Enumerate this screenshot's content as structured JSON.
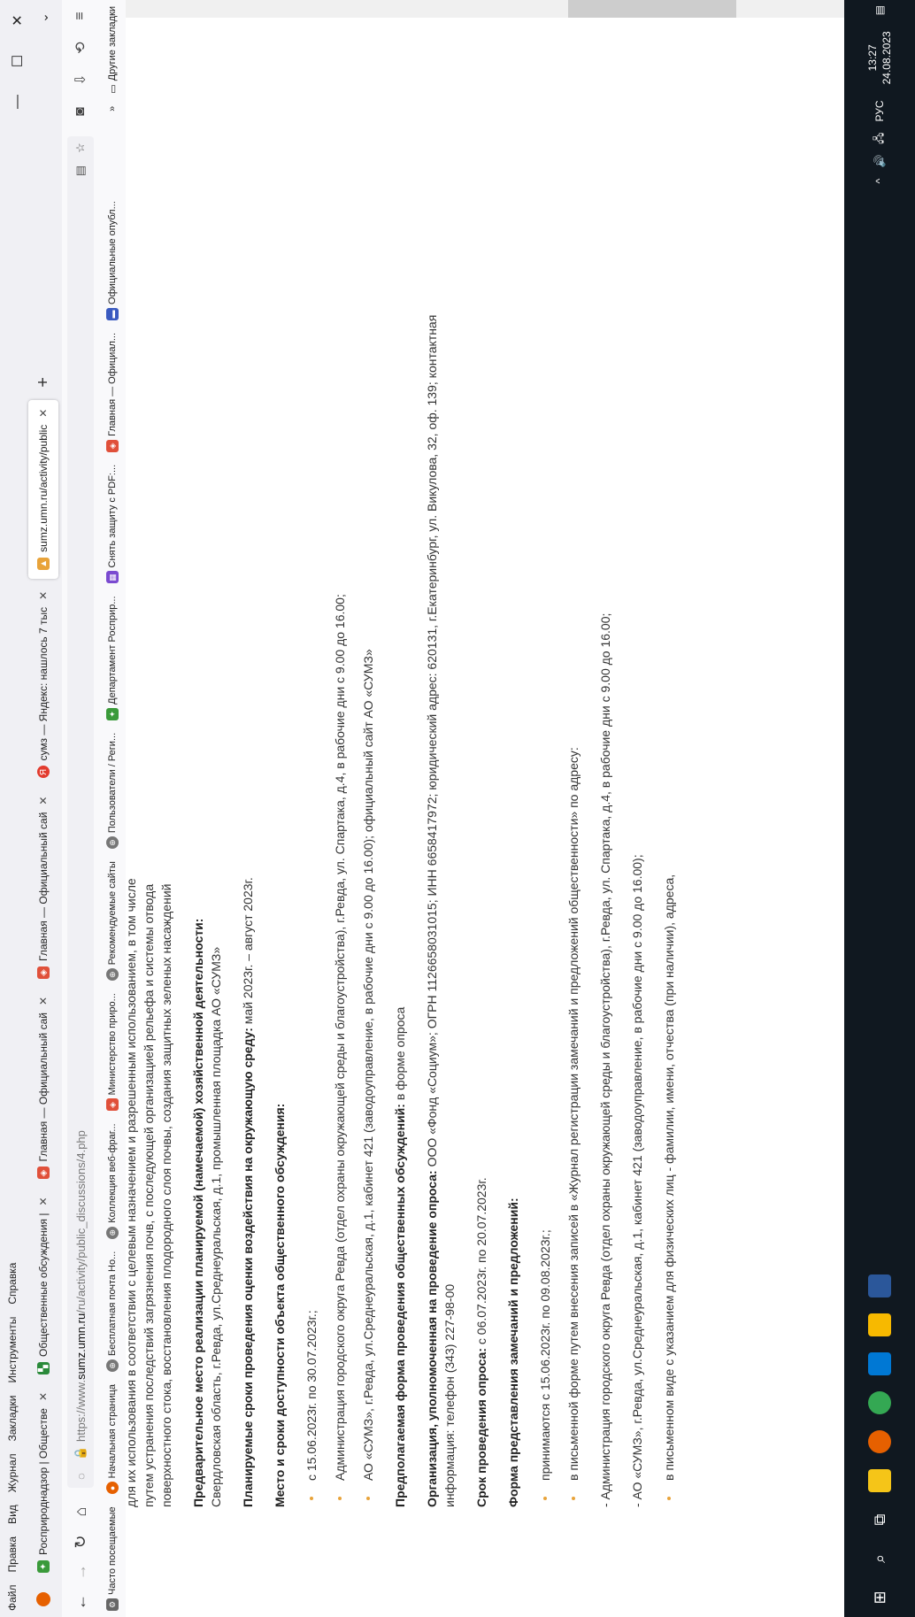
{
  "menu": [
    "Файл",
    "Правка",
    "Вид",
    "Журнал",
    "Закладки",
    "Инструменты",
    "Справка"
  ],
  "window_controls": {
    "minimize": "—",
    "maximize": "☐",
    "close": "✕"
  },
  "tabs": [
    {
      "title": "Росприроднадзор | Обществе",
      "color": "#3a9a3a",
      "icon": "✦"
    },
    {
      "title": "Общественные обсуждения |",
      "color": "#2a8a3a",
      "icon": "▚"
    },
    {
      "title": "Главная — Официальный сай",
      "color": "#e0503a",
      "icon": "◈"
    },
    {
      "title": "Главная — Официальный сай",
      "color": "#e0503a",
      "icon": "◈"
    },
    {
      "title": "сумз — Яндекс: нашлось 7 тыс",
      "color": "#e23b2e",
      "icon": "Я"
    },
    {
      "title": "sumz.umn.ru/activity/public",
      "color": "#e8a33a",
      "icon": "▲"
    }
  ],
  "newtab": "+",
  "nav": {
    "back": "←",
    "forward": "→",
    "reload": "↻",
    "home": "⌂",
    "url_prefix": "https://www.",
    "url_domain": "sumz.umn.ru",
    "url_path": "/ru/activity/public_discussions/4.php",
    "shield": "◌",
    "lock": "🔒",
    "reader": "▤",
    "star": "☆",
    "pocket": "◙",
    "downloads": "⇩",
    "sync": "⟲",
    "menu": "≡"
  },
  "bookmarks": [
    {
      "label": "Часто посещаемые",
      "color": "#666",
      "icon": "⚙"
    },
    {
      "label": "Начальная страница",
      "color": "#e66000",
      "icon": "●"
    },
    {
      "label": "Бесплатная почта Но...",
      "color": "#777",
      "icon": "⊕"
    },
    {
      "label": "Коллекция веб-фраг...",
      "color": "#777",
      "icon": "⊕"
    },
    {
      "label": "Министерство приро...",
      "color": "#e0503a",
      "icon": "◈"
    },
    {
      "label": "Рекомендуемые сайты",
      "color": "#777",
      "icon": "⊕"
    },
    {
      "label": "Пользователи / Реги...",
      "color": "#777",
      "icon": "⊕"
    },
    {
      "label": "Департамент Росприр...",
      "color": "#3a9a3a",
      "icon": "✦"
    },
    {
      "label": "Снять защиту с PDF:...",
      "color": "#7a4ad0",
      "icon": "▦"
    },
    {
      "label": "Главная — Официал...",
      "color": "#e0503a",
      "icon": "◈"
    },
    {
      "label": "Официальные опубл...",
      "color": "#3a5ac0",
      "icon": "▬"
    }
  ],
  "bookmarks_more": "»",
  "other_bookmarks": "Другие закладки",
  "content": {
    "intro_line1": "для их использования в соответствии с целевым назначением и разрешенным использованием, в том числе",
    "intro_line2": "путем устранения последствий загрязнения почв, с последующей организацией рельефа и системы отвода",
    "intro_line3": "поверхностного стока, восстановления плодородного слоя почвы, создания защитных зеленых насаждений",
    "place_label": "Предварительное место реализации планируемой (намечаемой) хозяйственной деятельности:",
    "place_value": "Свердловская область, г.Ревда, ул.Среднеуральская, д.1, промышленная площадка АО «СУМЗ»",
    "terms_label": "Планируемые сроки проведения оценки воздействия на окружающую среду:",
    "terms_value": " май 2023г. – август 2023г.",
    "access_label": "Место и сроки доступности объекта общественного обсуждения:",
    "access_items": [
      "с 15.06.2023г. по 30.07.2023г.;",
      "Администрация городского округа Ревда (отдел охраны окружающей среды и благоустройства), г.Ревда, ул. Спартака, д.4, в рабочие дни с 9.00 до 16.00;",
      "АО «СУМЗ», г.Ревда, ул.Среднеуральская, д.1, кабинет 421 (заводоуправление, в рабочие дни с 9.00 до 16.00); официальный сайт АО «СУМЗ»"
    ],
    "form_label": "Предполагаемая форма проведения общественных обсуждений:",
    "form_value": " в форме опроса",
    "org_label": "Организация, уполномоченная на проведение опроса:",
    "org_value": " ООО «Фонд «Социум»; ОГРН 1126658031015; ИНН 6658417972; юридический адрес: 620131, г.Екатеринбург, ул. Викулова, 32, оф. 139; контактная информация: телефон (343) 227-98-00",
    "survey_label": "Срок проведения опроса:",
    "survey_value": " с 06.07.2023г. по 20.07.2023г.",
    "remarks_label": "Форма представления замечаний и предложений:",
    "remarks_items": [
      "принимаются с 15.06.2023г. по 09.08.2023г.;",
      "в письменной форме путем внесения записей в «Журнал регистрации замечаний и предложений общественности» по адресу:"
    ],
    "admin_line": "- Администрация городского округа Ревда (отдел охраны окружающей среды и благоустройства), г.Ревда, ул. Спартака, д.4, в рабочие дни с 9.00 до 16.00;",
    "sumz_line": "- АО «СУМЗ», г.Ревда, ул.Среднеуральская, д.1, кабинет 421 (заводоуправление, в рабочие дни с 9.00 до 16.00);",
    "written_item": "в письменном виде с указанием для физических лиц - фамилии, имени, отчества (при наличии), адреса,"
  },
  "taskbar": {
    "start": "⊞",
    "search": "⌕",
    "taskview": "⧉",
    "apps": [
      {
        "name": "file-explorer",
        "color": "#f5c518"
      },
      {
        "name": "firefox",
        "color": "#e66000"
      },
      {
        "name": "chrome",
        "color": "#34a853"
      },
      {
        "name": "outlook",
        "color": "#0078d4"
      },
      {
        "name": "app-yellow",
        "color": "#f7b900"
      },
      {
        "name": "word",
        "color": "#2b579a"
      }
    ],
    "tray_chevron": "^",
    "volume": "🔊",
    "network": "🖧",
    "lang": "РУС",
    "time": "13:27",
    "date": "24.08.2023",
    "notifications": "▤"
  }
}
